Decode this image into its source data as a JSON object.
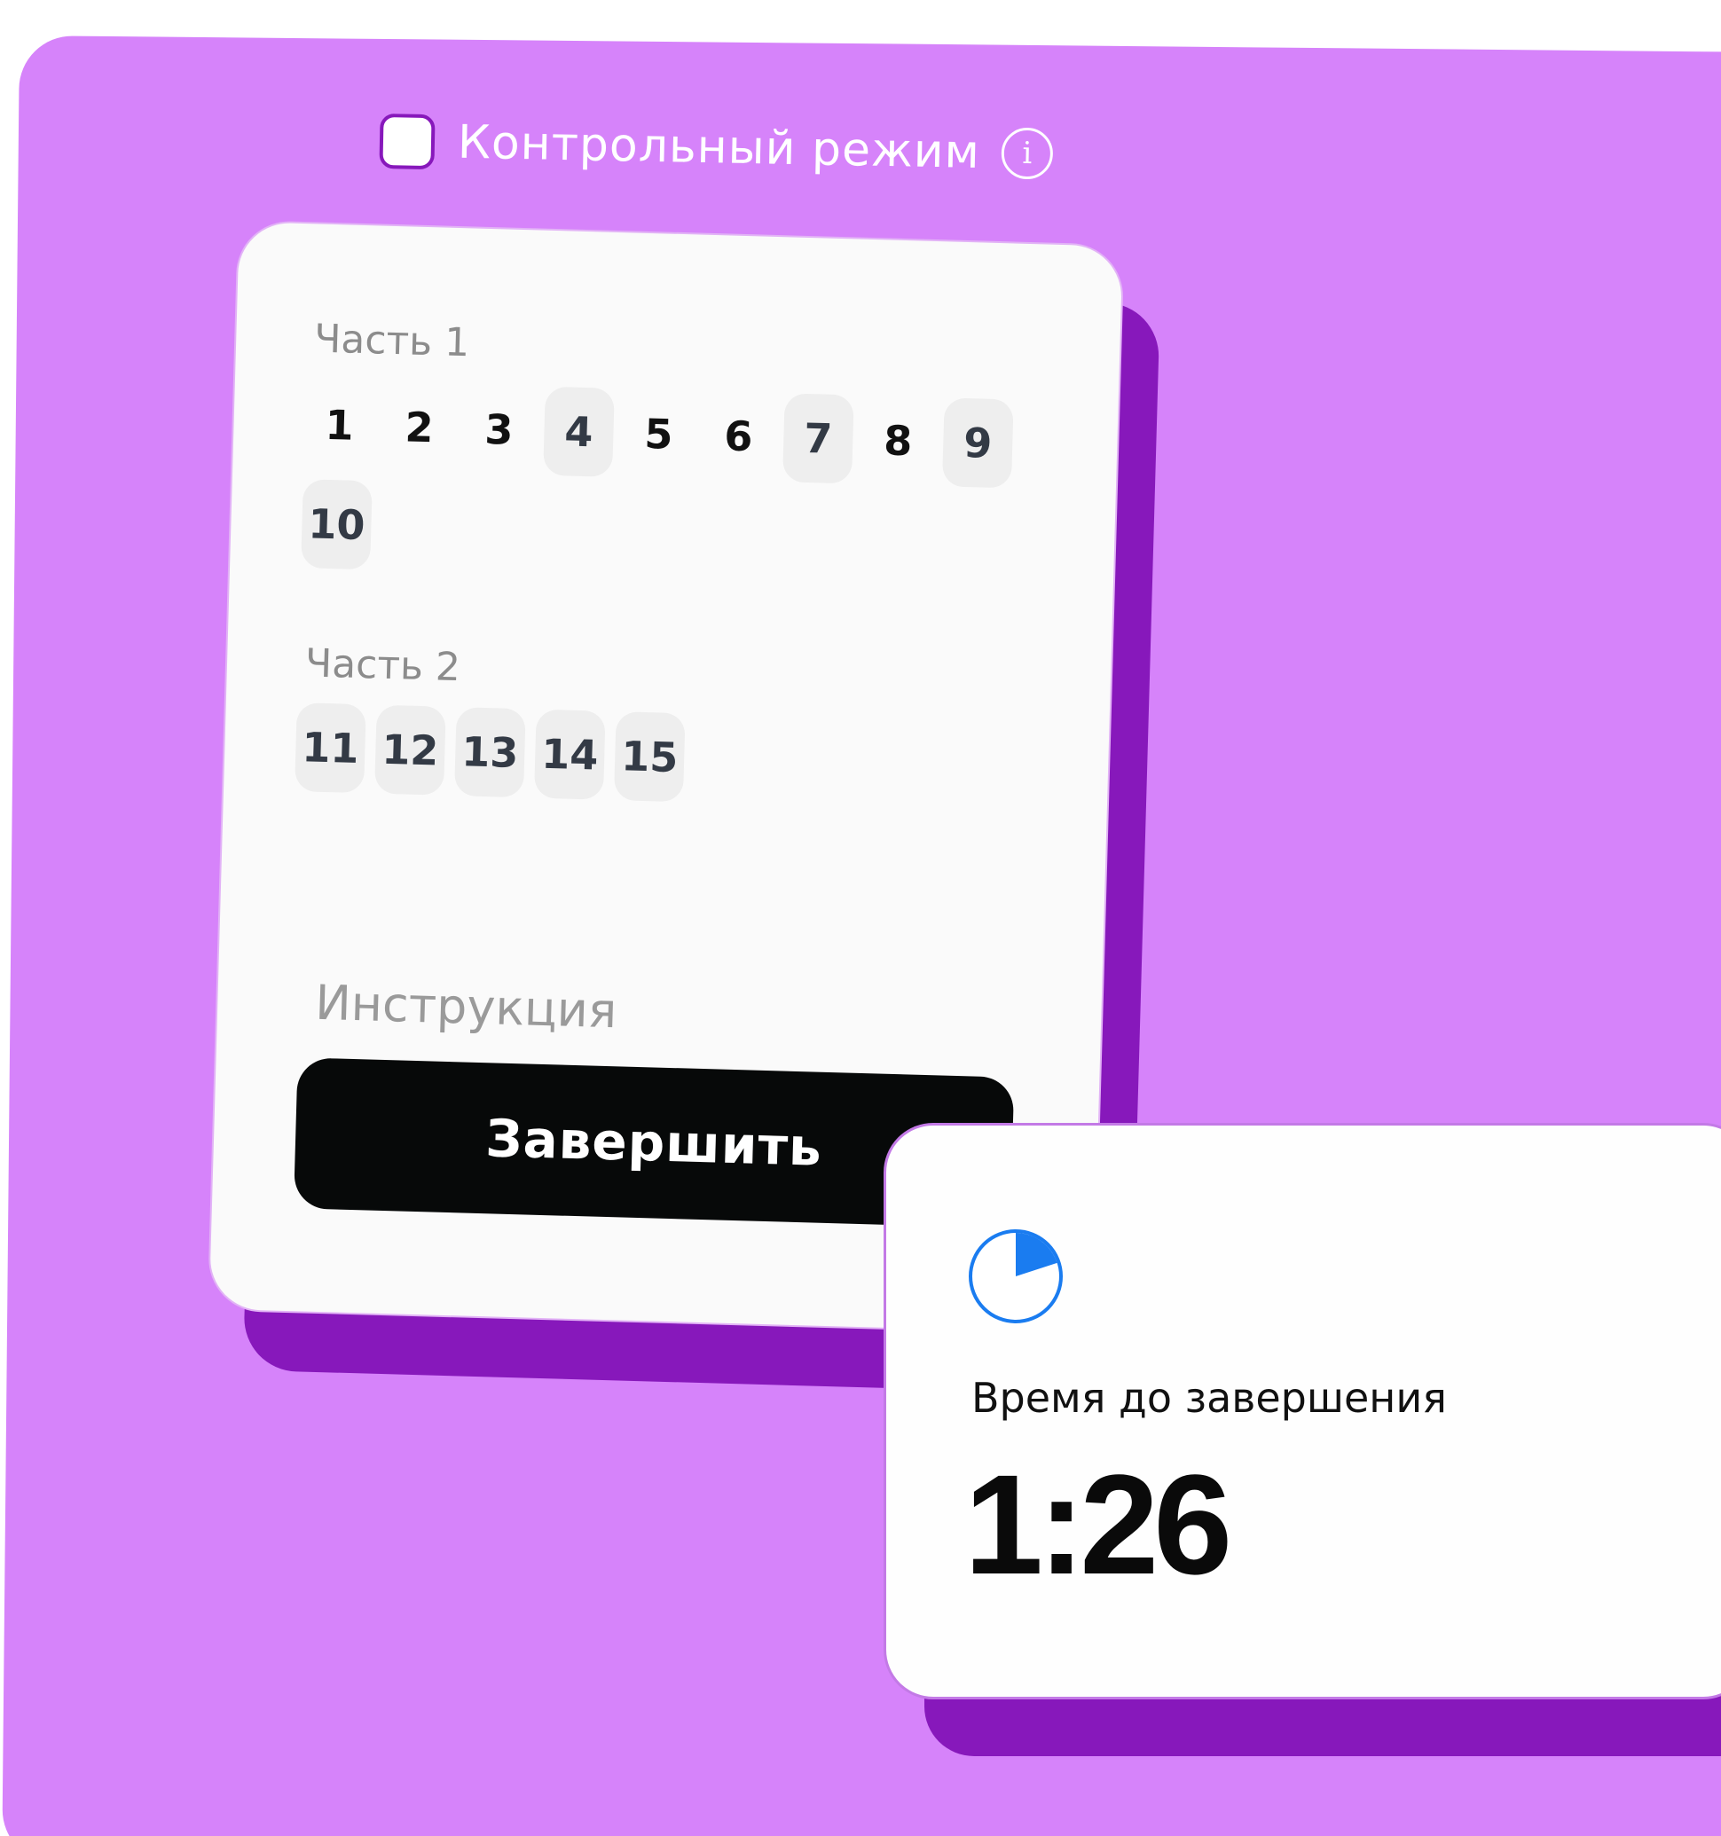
{
  "control_mode": {
    "label": "Контрольный режим",
    "checked": false,
    "info_icon": "info-icon"
  },
  "parts": [
    {
      "title": "Часть 1",
      "questions": [
        {
          "number": "1",
          "answered": false
        },
        {
          "number": "2",
          "answered": false
        },
        {
          "number": "3",
          "answered": false
        },
        {
          "number": "4",
          "answered": true
        },
        {
          "number": "5",
          "answered": false
        },
        {
          "number": "6",
          "answered": false
        },
        {
          "number": "7",
          "answered": true
        },
        {
          "number": "8",
          "answered": false
        },
        {
          "number": "9",
          "answered": true
        },
        {
          "number": "10",
          "answered": true
        }
      ]
    },
    {
      "title": "Часть 2",
      "questions": [
        {
          "number": "11",
          "answered": true
        },
        {
          "number": "12",
          "answered": true
        },
        {
          "number": "13",
          "answered": true
        },
        {
          "number": "14",
          "answered": true
        },
        {
          "number": "15",
          "answered": true
        }
      ]
    }
  ],
  "instruction_label": "Инструкция",
  "finish_button": "Завершить",
  "timer": {
    "icon": "timer-pie-icon",
    "label": "Время до завершения",
    "value": "1:26",
    "elapsed_fraction": 0.2,
    "accent_color": "#1a7cf0"
  },
  "colors": {
    "background": "#d683fa",
    "shadow": "#8718bb",
    "card": "#fafafa",
    "button": "#070909"
  }
}
